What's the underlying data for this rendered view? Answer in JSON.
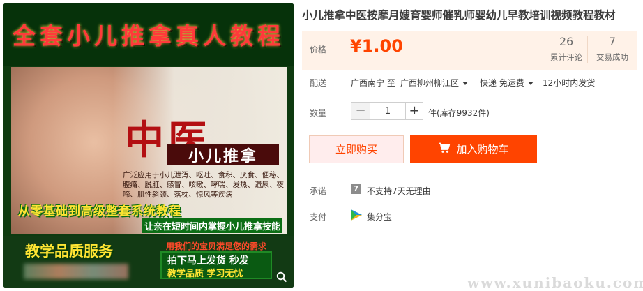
{
  "product_image": {
    "headline": "全套小儿推拿真人教程",
    "big_text": "中医",
    "sub_label": "小儿推拿",
    "applications": "广泛应用于小儿泄泻、呕吐、食积、厌食、便秘、腹痛、脱肛、感冒、咳嗽、哮喘、发热、遗尿、夜啼、肌性斜颈、落枕、惊风等疾病",
    "tagline": "从零基础到高级整套系统教程",
    "tagline2": "让亲在短时间内掌握小儿推拿技能",
    "quality": "教学品质服务",
    "satisfy": "用我们的宝贝满足您的需求",
    "ship_line1": "拍下马上发货 秒发",
    "ship_line2": "教学品质 学习无忧",
    "zoom_icon": "search-icon"
  },
  "title": "小儿推拿中医按摩月嫂育婴师催乳师婴幼儿早教培训视频教程教材",
  "price": {
    "label": "价格",
    "value": "¥1.00",
    "reviews_count": "26",
    "reviews_label": "累计评论",
    "trades_count": "7",
    "trades_label": "交易成功"
  },
  "delivery": {
    "label": "配送",
    "from": "广西南宁 至",
    "to": "广西柳州柳江区",
    "method": "快递 免运费",
    "ship_time": "12小时内发货"
  },
  "quantity": {
    "label": "数量",
    "value": "1",
    "minus": "−",
    "plus": "+",
    "stock": "件(库存9932件)"
  },
  "buttons": {
    "buy_now": "立即购买",
    "add_to_cart": "加入购物车"
  },
  "promise": {
    "label": "承诺",
    "icon": "7",
    "text": "不支持7天无理由"
  },
  "payment": {
    "label": "支付",
    "text": "集分宝"
  },
  "watermark": "www.xunibaoku.com",
  "colors": {
    "accent": "#ff4400",
    "price_bg": "#fff2e8",
    "image_green": "#0e3a10"
  }
}
